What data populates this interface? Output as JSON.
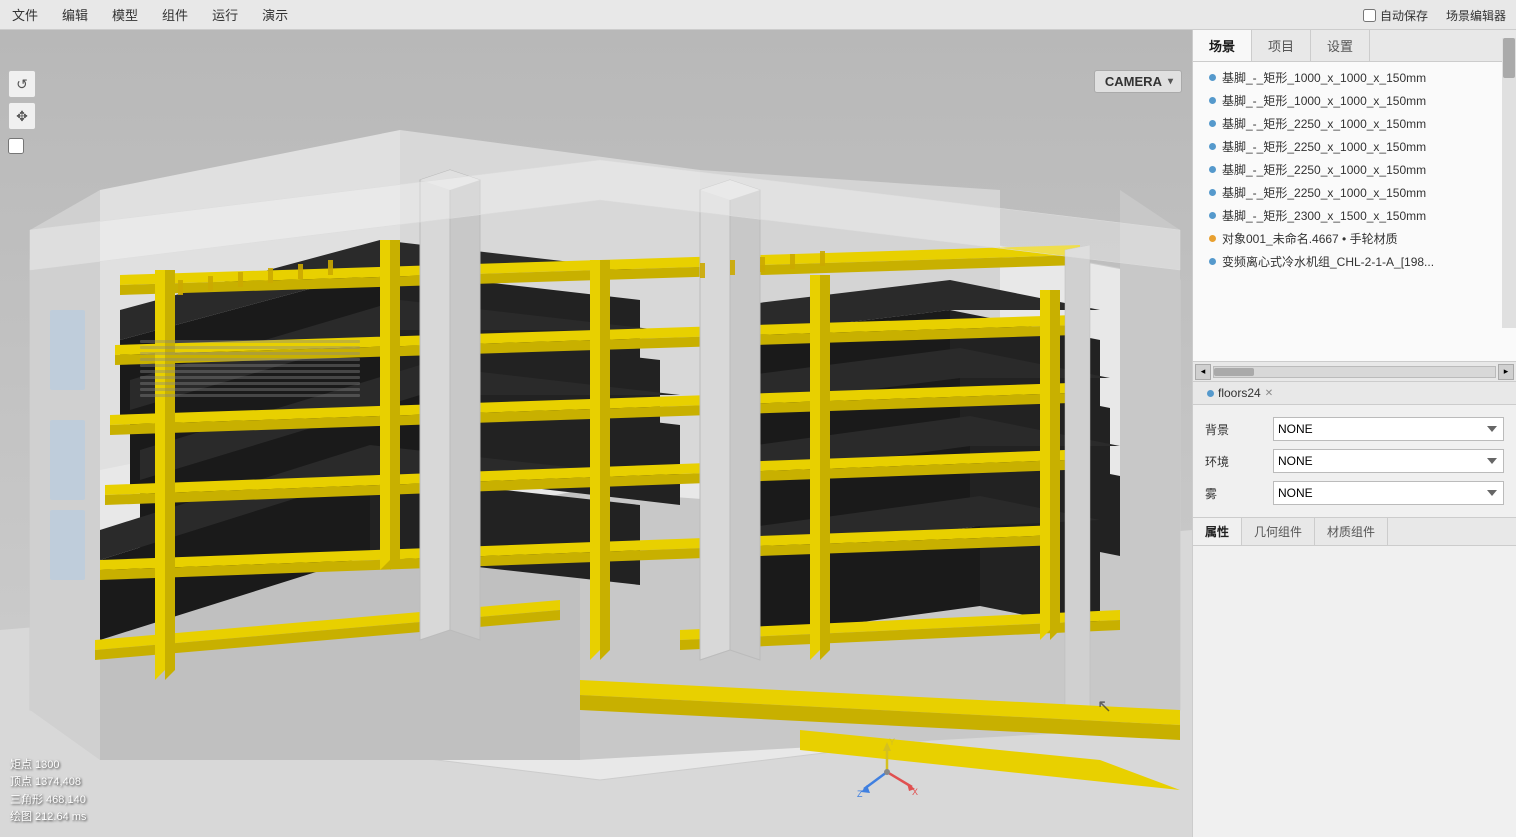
{
  "menu": {
    "items": [
      "文件",
      "编辑",
      "模型",
      "组件",
      "运行",
      "演示"
    ]
  },
  "top_right": {
    "auto_save": "自动保存",
    "scene_editor": "场景编辑器"
  },
  "camera": {
    "label": "CAMERA",
    "arrow": "▾"
  },
  "viewport_stats": {
    "line1": "矩点 1300",
    "line2": "顶点 1374,408",
    "line3": "三角形 468,140",
    "line4": "绘图 212.64 ms"
  },
  "right_panel": {
    "tabs": [
      {
        "label": "场景",
        "active": true
      },
      {
        "label": "项目",
        "active": false
      },
      {
        "label": "设置",
        "active": false
      }
    ],
    "tree_items": [
      {
        "dot": "blue",
        "label": "基脚_-_矩形_1000_x_1000_x_150mm"
      },
      {
        "dot": "blue",
        "label": "基脚_-_矩形_1000_x_1000_x_150mm"
      },
      {
        "dot": "blue",
        "label": "基脚_-_矩形_2250_x_1000_x_150mm"
      },
      {
        "dot": "blue",
        "label": "基脚_-_矩形_2250_x_1000_x_150mm"
      },
      {
        "dot": "blue",
        "label": "基脚_-_矩形_2250_x_1000_x_150mm"
      },
      {
        "dot": "blue",
        "label": "基脚_-_矩形_2250_x_1000_x_150mm"
      },
      {
        "dot": "blue",
        "label": "基脚_-_矩形_2300_x_1500_x_150mm"
      },
      {
        "dot": "orange",
        "label": "对象001_未命名.4667   •  手轮材质"
      },
      {
        "dot": "blue",
        "label": "变频离心式冷水机组_CHL-2-1-A_[198..."
      }
    ],
    "floors_tab": {
      "label": "floors24",
      "dot": "blue"
    },
    "properties": [
      {
        "label": "背景",
        "value": "NONE"
      },
      {
        "label": "环境",
        "value": "NONE"
      },
      {
        "label": "雾",
        "value": "NONE"
      }
    ],
    "property_options": [
      "NONE"
    ],
    "bottom_tabs": [
      {
        "label": "属性",
        "active": true
      },
      {
        "label": "几何组件",
        "active": false
      },
      {
        "label": "材质组件",
        "active": false
      }
    ]
  },
  "toolbar": {
    "buttons": [
      {
        "name": "rotate-icon",
        "symbol": "↺",
        "label": "旋转"
      },
      {
        "name": "move-icon",
        "symbol": "✥",
        "label": "移动"
      },
      {
        "name": "checkbox-icon",
        "symbol": "☐",
        "label": "复选框"
      }
    ]
  },
  "axes": {
    "x_color": "#e05050",
    "y_color": "#d4c020",
    "z_color": "#4080e0"
  }
}
